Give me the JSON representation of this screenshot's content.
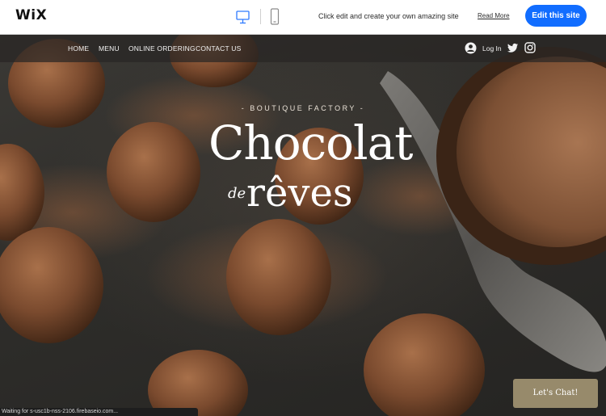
{
  "wix_bar": {
    "logo": "WiX",
    "promo_text": "Click edit and create your own amazing site",
    "read_more": "Read More",
    "edit_button": "Edit this site",
    "accent_color": "#116dff",
    "device_icons": [
      "desktop-icon",
      "mobile-icon"
    ]
  },
  "nav": {
    "items": [
      {
        "label": "HOME"
      },
      {
        "label": "MENU"
      },
      {
        "label": "ONLINE ORDERING"
      },
      {
        "label": "CONTACT US"
      }
    ],
    "login": "Log In",
    "social_icons": [
      "twitter-icon",
      "instagram-icon"
    ]
  },
  "hero": {
    "tagline": "- BOUTIQUE FACTORY -",
    "title_line1": "Chocolat",
    "title_de": "de",
    "title_line2": "rêves"
  },
  "chat": {
    "label": "Let's Chat!",
    "color": "#978a6b"
  },
  "status": {
    "text": "Waiting for s-usc1b-nss-2106.firebaseio.com..."
  }
}
